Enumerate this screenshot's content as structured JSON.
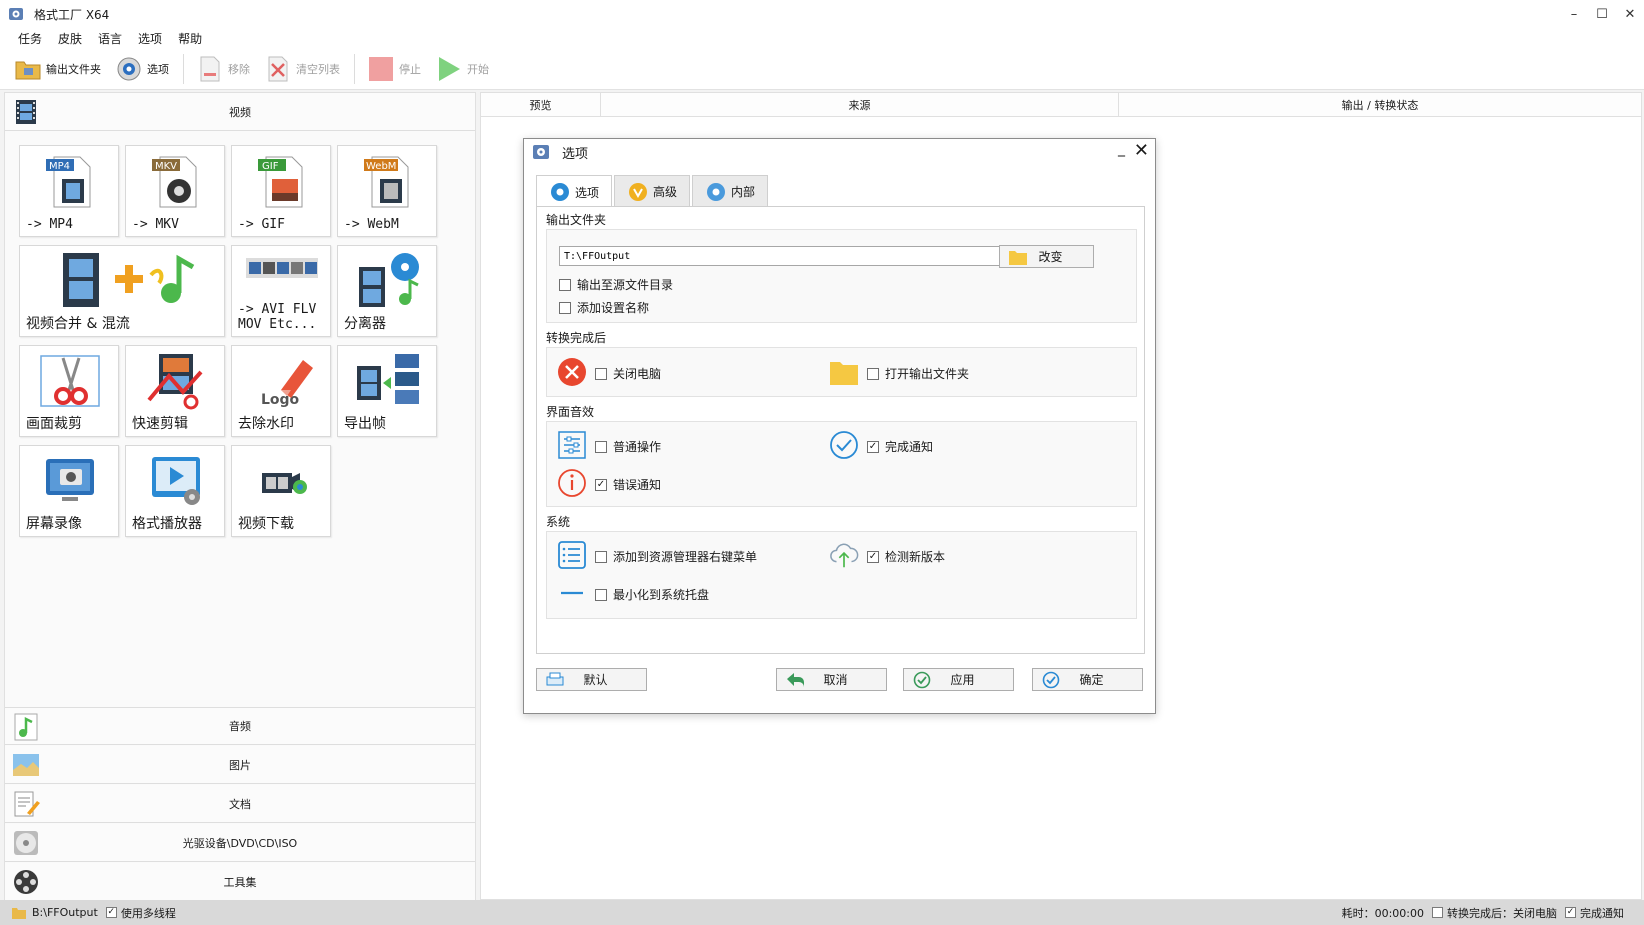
{
  "window": {
    "title": "格式工厂 X64",
    "controls": [
      "–",
      "☐",
      "✕"
    ]
  },
  "menu": [
    "任务",
    "皮肤",
    "语言",
    "选项",
    "帮助"
  ],
  "toolbar": {
    "output_folder": "输出文件夹",
    "options": "选项",
    "remove": "移除",
    "clear_list": "清空列表",
    "stop": "停止",
    "start": "开始"
  },
  "left": {
    "video_header": "视频",
    "tiles": [
      {
        "label": "-> MP4",
        "badge": "MP4",
        "badge_color": "#2f6db5"
      },
      {
        "label": "-> MKV",
        "badge": "MKV",
        "badge_color": "#8a6b3a"
      },
      {
        "label": "-> GIF",
        "badge": "GIF",
        "badge_color": "#3a9a3a"
      },
      {
        "label": "-> WebM",
        "badge": "WebM",
        "badge_color": "#d07a1a"
      },
      {
        "label": "视频合并 & 混流"
      },
      {
        "label": "-> AVI FLV\nMOV Etc..."
      },
      {
        "label": "分离器"
      },
      {
        "label": "画面裁剪"
      },
      {
        "label": "快速剪辑"
      },
      {
        "label": "去除水印",
        "logo_text": "Logo"
      },
      {
        "label": "导出帧"
      },
      {
        "label": "屏幕录像"
      },
      {
        "label": "格式播放器"
      },
      {
        "label": "视频下载"
      }
    ],
    "categories": [
      "音频",
      "图片",
      "文档",
      "光驱设备\\DVD\\CD\\ISO",
      "工具集"
    ]
  },
  "columns": [
    "预览",
    "来源",
    "输出 / 转换状态"
  ],
  "dialog": {
    "title": "选项",
    "tabs": [
      "选项",
      "高级",
      "内部"
    ],
    "output_folder_label": "输出文件夹",
    "output_path": "T:\\FFOutput",
    "change_button": "改变",
    "output_to_source": "输出至源文件目录",
    "add_setting_name": "添加设置名称",
    "after_convert_label": "转换完成后",
    "shutdown": "关闭电脑",
    "open_output": "打开输出文件夹",
    "ui_sound_label": "界面音效",
    "normal_op": "普通操作",
    "complete_notify": "完成通知",
    "error_notify": "错误通知",
    "system_label": "系统",
    "context_menu": "添加到资源管理器右键菜单",
    "check_update": "检测新版本",
    "minimize_tray": "最小化到系统托盘",
    "buttons": {
      "default": "默认",
      "cancel": "取消",
      "apply": "应用",
      "ok": "确定"
    },
    "checked": {
      "output_to_source": false,
      "add_setting_name": false,
      "shutdown": false,
      "open_output": false,
      "normal_op": false,
      "complete_notify": true,
      "error_notify": true,
      "context_menu": false,
      "check_update": true,
      "minimize_tray": false
    }
  },
  "status": {
    "path": "B:\\FFOutput",
    "multithread": "使用多线程",
    "elapsed": "耗时：00:00:00",
    "after_convert": "转换完成后：关闭电脑",
    "complete_notify": "完成通知"
  },
  "colors": {
    "accent_blue": "#2a8ad4",
    "red": "#e8472f",
    "folder_yellow": "#f5c842",
    "green_play": "#4cc04c"
  }
}
